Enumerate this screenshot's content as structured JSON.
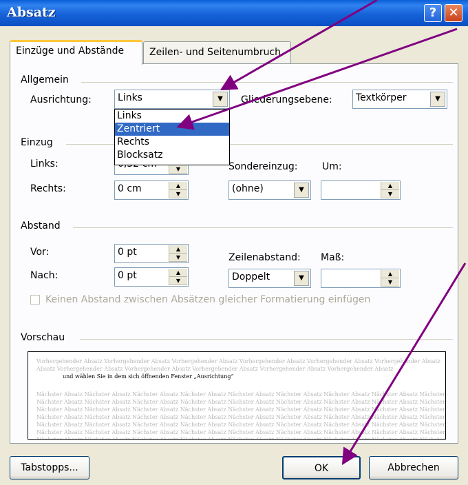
{
  "window": {
    "title": "Absatz",
    "help": "?",
    "close": "✕"
  },
  "tabs": [
    {
      "label": "Einzüge und Abstände"
    },
    {
      "label": "Zeilen- und Seitenumbruch"
    }
  ],
  "allgemein": {
    "heading": "Allgemein",
    "ausrichtung_label": "Ausrichtung:",
    "ausrichtung_value": "Links",
    "gliederung_label": "Gliederungsebene:",
    "gliederung_value": "Textkörper",
    "dropdown_options": [
      "Links",
      "Zentriert",
      "Rechts",
      "Blocksatz"
    ],
    "dropdown_selected": "Zentriert"
  },
  "einzug": {
    "heading": "Einzug",
    "links_label": "Links:",
    "links_value": "0,32 cm",
    "rechts_label": "Rechts:",
    "rechts_value": "0 cm",
    "sonder_label": "Sondereinzug:",
    "sonder_value": "(ohne)",
    "um_label": "Um:",
    "um_value": ""
  },
  "abstand": {
    "heading": "Abstand",
    "vor_label": "Vor:",
    "vor_value": "0 pt",
    "nach_label": "Nach:",
    "nach_value": "0 pt",
    "zeilen_label": "Zeilenabstand:",
    "zeilen_value": "Doppelt",
    "mass_label": "Maß:",
    "mass_value": "",
    "checkbox_label": "Keinen Abstand zwischen Absätzen gleicher Formatierung einfügen"
  },
  "vorschau": {
    "heading": "Vorschau",
    "prev_line_1": "Vorhergehender Absatz Vorhergehender Absatz Vorhergehender Absatz Vorhergehender Absatz Vorhergehender Absatz Vorhergehender Absatz",
    "prev_line_2": "Absatz Vorhergehender Absatz Vorhergehender Absatz Vorhergehender Absatz Vorhergehender Absatz Vorhergehender Absatz",
    "main_line": "und wählen Sie in dem sich öffnenden Fenster „Ausrichtung“",
    "next_line": "Nächster Absatz Nächster Absatz Nächster Absatz Nächster Absatz Nächster Absatz Nächster Absatz Nächster Absatz Nächster Absatz Nächster"
  },
  "buttons": {
    "tabstopps": "Tabstopps...",
    "ok": "OK",
    "abbrechen": "Abbrechen"
  },
  "colors": {
    "arrow": "#800080",
    "selection": "#316ac5",
    "titlebar": "#0a5fd8"
  }
}
